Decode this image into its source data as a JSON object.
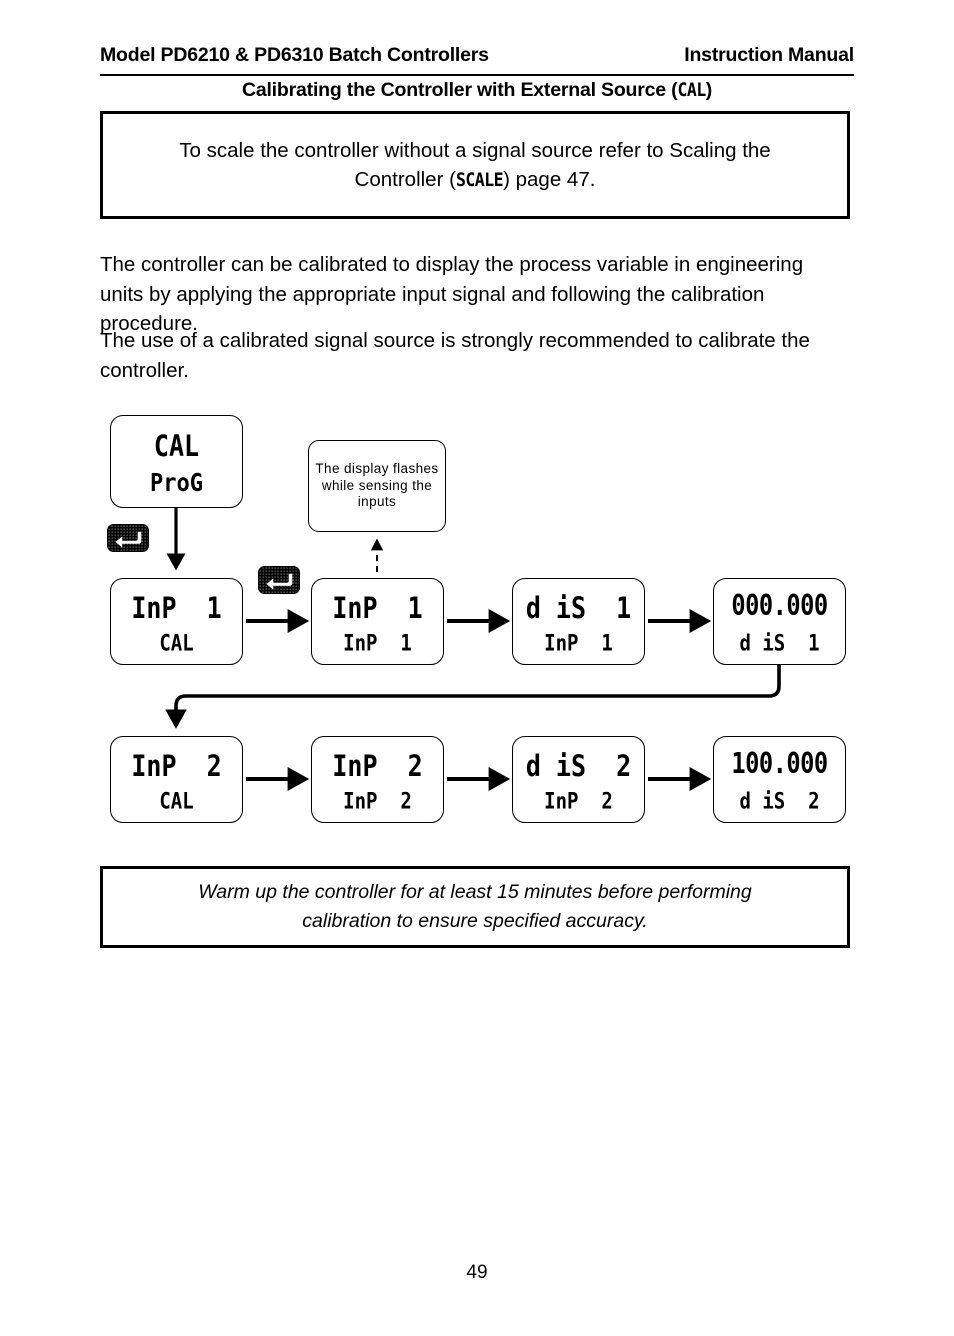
{
  "header": {
    "left_title": "Model PD6210 & PD6310 Batch Controllers",
    "right_title": "Instruction Manual",
    "section_title_prefix": "Calibrating the Controller with External Source (",
    "section_title_code": "CAL",
    "section_title_suffix": ")"
  },
  "note_top": {
    "line1": "To scale the controller without a signal source refer to Scaling the",
    "line2_prefix": "Controller (",
    "line2_code": "SCALE",
    "line2_suffix": ") page 47."
  },
  "paragraphs": {
    "p1": "The controller can be calibrated to display the process variable in engineering units by applying the appropriate input signal and following the calibration procedure.",
    "p2": "The use of a calibrated signal source is strongly recommended to calibrate the controller."
  },
  "callout": {
    "text": "The display flashes while sensing the inputs"
  },
  "flow": {
    "start_box": {
      "main": "CAL",
      "sub": "ProG"
    },
    "row1": [
      {
        "main": "InP  1",
        "sub": "CAL",
        "numeric": false
      },
      {
        "main": "InP  1",
        "sub": "InP  1",
        "numeric": false
      },
      {
        "main": "d iS  1",
        "sub": "InP  1",
        "numeric": false
      },
      {
        "main": "000.000",
        "sub": "d iS  1",
        "numeric": true
      }
    ],
    "row2": [
      {
        "main": "InP  2",
        "sub": "CAL",
        "numeric": false
      },
      {
        "main": "InP  2",
        "sub": "InP  2",
        "numeric": false
      },
      {
        "main": "d iS  2",
        "sub": "InP  2",
        "numeric": false
      },
      {
        "main": "100.000",
        "sub": "d iS  2",
        "numeric": true
      }
    ],
    "keys": [
      {
        "name": "enter-key",
        "label": "Enter"
      },
      {
        "name": "enter-key",
        "label": "Enter"
      }
    ]
  },
  "note_bottom": {
    "line1": "Warm up the controller for at least 15 minutes before performing",
    "line2": "calibration to ensure specified accuracy."
  },
  "footer": {
    "page_number": "49"
  },
  "colors": {
    "ink": "#000000",
    "paper": "#ffffff",
    "ghost_segment": "#9a9a9a"
  }
}
